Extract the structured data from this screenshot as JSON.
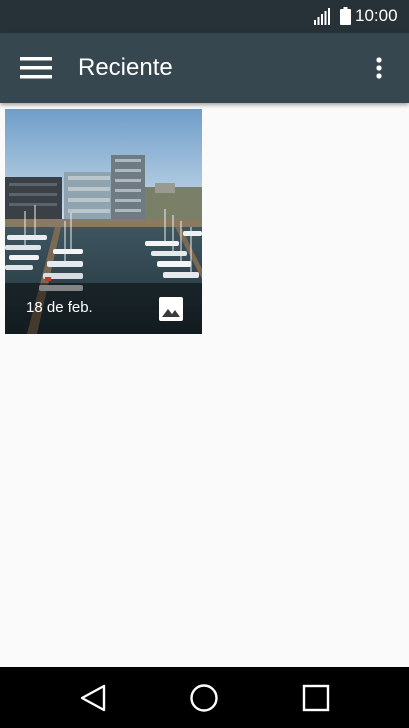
{
  "status_bar": {
    "time": "10:00",
    "icons": [
      "signal-icon",
      "battery-icon"
    ]
  },
  "app_bar": {
    "title": "Reciente",
    "left_icon": "hamburger-menu-icon",
    "right_icon": "more-vert-icon"
  },
  "gallery": {
    "items": [
      {
        "date_label": "18 de feb.",
        "type_icon": "image-icon",
        "scene": "harbor-marina-photo"
      }
    ]
  },
  "nav_bar": {
    "buttons": [
      "back-icon",
      "home-icon",
      "recents-icon"
    ]
  },
  "colors": {
    "status_bar": "#263238",
    "app_bar": "#37474f",
    "background": "#fafafa",
    "nav_bar": "#000000"
  }
}
